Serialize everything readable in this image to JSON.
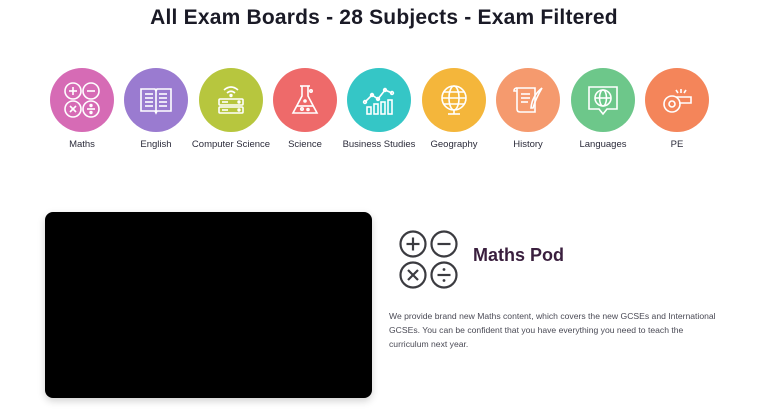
{
  "page": {
    "title": "All Exam Boards - 28 Subjects - Exam Filtered"
  },
  "subjects": [
    {
      "label": "Maths",
      "color": "#d66bb5",
      "icon": "maths-icon"
    },
    {
      "label": "English",
      "color": "#9a7bd0",
      "icon": "book-icon"
    },
    {
      "label": "Computer Science",
      "color": "#b7c63e",
      "icon": "computer-icon"
    },
    {
      "label": "Science",
      "color": "#ee6a6a",
      "icon": "flask-icon"
    },
    {
      "label": "Business Studies",
      "color": "#35c6c6",
      "icon": "chart-icon"
    },
    {
      "label": "Geography",
      "color": "#f4b63b",
      "icon": "globe-icon"
    },
    {
      "label": "History",
      "color": "#f59a6e",
      "icon": "scroll-icon"
    },
    {
      "label": "Languages",
      "color": "#6dc78a",
      "icon": "language-globe-icon"
    },
    {
      "label": "PE",
      "color": "#f4855a",
      "icon": "whistle-icon"
    }
  ],
  "pod": {
    "title": "Maths Pod",
    "description": "We provide brand new Maths content, which covers the new GCSEs and International GCSEs. You can be confident that you have everything you need to teach the curriculum next year."
  }
}
